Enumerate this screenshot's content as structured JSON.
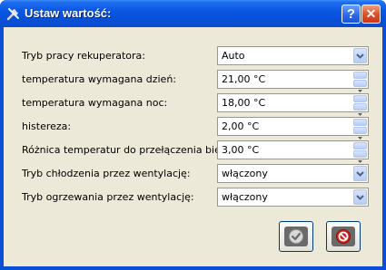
{
  "window": {
    "title": "Ustaw wartość:",
    "help_label": "?",
    "close_label": "✕"
  },
  "form": {
    "rows": [
      {
        "label": "Tryb pracy rekuperatora:",
        "value": "Auto",
        "control": "dropdown"
      },
      {
        "label": "temperatura wymagana dzień:",
        "value": "21,00 °C",
        "control": "spinbox"
      },
      {
        "label": "temperatura wymagana noc:",
        "value": "18,00 °C",
        "control": "spinbox"
      },
      {
        "label": "histereza:",
        "value": "2,00 °C",
        "control": "spinbox"
      },
      {
        "label": "Różnica temperatur do przełączenia biegu:",
        "value": "3,00 °C",
        "control": "spinbox"
      },
      {
        "label": "Tryb chłodzenia przez wentylację:",
        "value": "włączony",
        "control": "dropdown"
      },
      {
        "label": "Tryb ogrzewania przez wentylację:",
        "value": "włączony",
        "control": "dropdown"
      }
    ]
  },
  "icons": {
    "app": "tools-icon",
    "ok": "ok-check-icon",
    "cancel": "cancel-icon"
  },
  "colors": {
    "titlebar": "#0a56e2",
    "field_border": "#7f9db9",
    "dialog_bg": "#ece9d8",
    "cancel_red": "#d8201a"
  }
}
